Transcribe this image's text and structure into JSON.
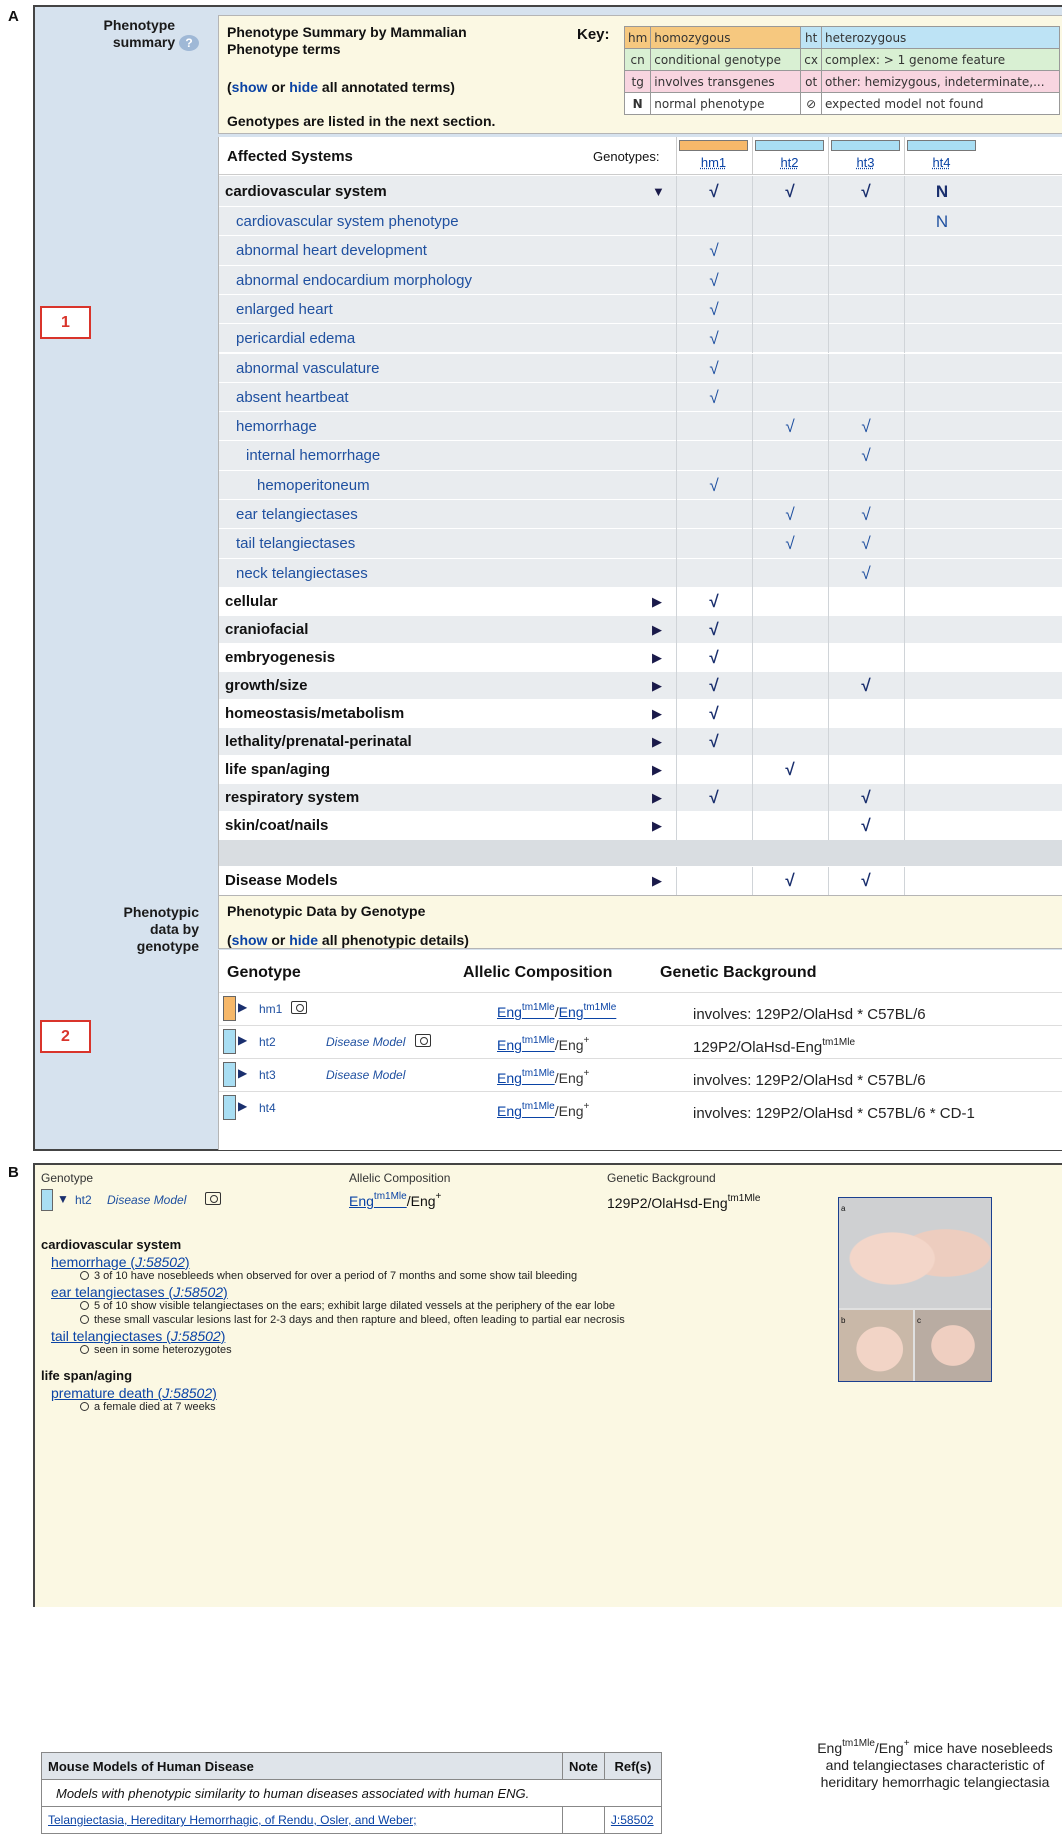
{
  "panel_a_label": "A",
  "panel_b_label": "B",
  "phenotype_summary": {
    "left_label": "Phenotype summary",
    "help_icon": "question-circle-icon",
    "title": "Phenotype Summary by Mammalian Phenotype terms",
    "show_label": "show",
    "or_label": " or ",
    "hide_label": "hide",
    "all_annotated_terms": " all annotated terms)",
    "genotypes_note": "Genotypes are listed in the next section.",
    "key_label": "Key:",
    "key_items": [
      {
        "abbr": "hm",
        "text": "homozygous",
        "color": "#f6c87f"
      },
      {
        "abbr": "ht",
        "text": "heterozygous",
        "color": "#bde3f5"
      },
      {
        "abbr": "cn",
        "text": "conditional genotype",
        "color": "#d9f0d3"
      },
      {
        "abbr": "cx",
        "text": "complex: > 1 genome feature",
        "color": "#d9f0d3"
      },
      {
        "abbr": "tg",
        "text": "involves transgenes",
        "color": "#f8d5e0"
      },
      {
        "abbr": "ot",
        "text": "other: hemizygous, indeterminate,...",
        "color": "#f8d5e0"
      },
      {
        "abbr": "N",
        "text": "normal phenotype",
        "color": "#ffffff"
      },
      {
        "abbr": "⊘",
        "text": "expected model not found",
        "color": "#ffffff"
      }
    ]
  },
  "affected_systems": {
    "title": "Affected Systems",
    "genotypes_label": "Genotypes:",
    "genotype_cols": [
      {
        "label": "hm1",
        "color": "#f6b86a"
      },
      {
        "label": "ht2",
        "color": "#a9def3"
      },
      {
        "label": "ht3",
        "color": "#a9def3"
      },
      {
        "label": "ht4",
        "color": "#a9def3"
      }
    ],
    "rows": [
      {
        "name": "cardiovascular system",
        "level": 0,
        "arrow": "▼",
        "cells": [
          "√",
          "√",
          "√",
          "N"
        ]
      },
      {
        "name": "cardiovascular system phenotype",
        "level": 1,
        "cells": [
          "",
          "",
          "",
          "N"
        ]
      },
      {
        "name": "abnormal heart development",
        "level": 1,
        "cells": [
          "√",
          "",
          "",
          ""
        ]
      },
      {
        "name": "abnormal endocardium morphology",
        "level": 1,
        "cells": [
          "√",
          "",
          "",
          ""
        ]
      },
      {
        "name": "enlarged heart",
        "level": 1,
        "cells": [
          "√",
          "",
          "",
          ""
        ]
      },
      {
        "name": "pericardial edema",
        "level": 1,
        "cells": [
          "√",
          "",
          "",
          ""
        ]
      },
      {
        "name": "abnormal vasculature",
        "level": 1,
        "cells": [
          "√",
          "",
          "",
          ""
        ]
      },
      {
        "name": "absent heartbeat",
        "level": 1,
        "cells": [
          "√",
          "",
          "",
          ""
        ]
      },
      {
        "name": "hemorrhage",
        "level": 1,
        "cells": [
          "",
          "√",
          "√",
          ""
        ]
      },
      {
        "name": "internal hemorrhage",
        "level": 2,
        "cells": [
          "",
          "",
          "√",
          ""
        ]
      },
      {
        "name": "hemoperitoneum",
        "level": 3,
        "cells": [
          "√",
          "",
          "",
          ""
        ]
      },
      {
        "name": "ear telangiectases",
        "level": 1,
        "cells": [
          "",
          "√",
          "√",
          ""
        ]
      },
      {
        "name": "tail telangiectases",
        "level": 1,
        "cells": [
          "",
          "√",
          "√",
          ""
        ]
      },
      {
        "name": "neck telangiectases",
        "level": 1,
        "cells": [
          "",
          "",
          "√",
          ""
        ]
      },
      {
        "name": "cellular",
        "level": 0,
        "arrow": "▶",
        "cells": [
          "√",
          "",
          "",
          ""
        ]
      },
      {
        "name": "craniofacial",
        "level": 0,
        "arrow": "▶",
        "cells": [
          "√",
          "",
          "",
          ""
        ]
      },
      {
        "name": "embryogenesis",
        "level": 0,
        "arrow": "▶",
        "cells": [
          "√",
          "",
          "",
          ""
        ]
      },
      {
        "name": "growth/size",
        "level": 0,
        "arrow": "▶",
        "cells": [
          "√",
          "",
          "√",
          ""
        ]
      },
      {
        "name": "homeostasis/metabolism",
        "level": 0,
        "arrow": "▶",
        "cells": [
          "√",
          "",
          "",
          ""
        ]
      },
      {
        "name": "lethality/prenatal-perinatal",
        "level": 0,
        "arrow": "▶",
        "cells": [
          "√",
          "",
          "",
          ""
        ]
      },
      {
        "name": "life span/aging",
        "level": 0,
        "arrow": "▶",
        "cells": [
          "",
          "√",
          "",
          ""
        ]
      },
      {
        "name": "respiratory system",
        "level": 0,
        "arrow": "▶",
        "cells": [
          "√",
          "",
          "√",
          ""
        ]
      },
      {
        "name": "skin/coat/nails",
        "level": 0,
        "arrow": "▶",
        "cells": [
          "",
          "",
          "√",
          ""
        ]
      }
    ],
    "disease_row": {
      "name": "Disease Models",
      "arrow": "▶",
      "cells": [
        "",
        "√",
        "√",
        ""
      ]
    }
  },
  "phenotypic_data": {
    "left_label": "Phenotypic data by genotype",
    "title": "Phenotypic Data by Genotype",
    "show_label": "show",
    "or_label": " or ",
    "hide_label": "hide",
    "all_details": " all phenotypic details)",
    "headers": {
      "genotype": "Genotype",
      "allelic": "Allelic Composition",
      "background": "Genetic Background"
    },
    "rows": [
      {
        "name": "hm1",
        "disease": "",
        "camera": true,
        "color": "#f6b86a",
        "a1": "Eng",
        "s1": "tm1Mle",
        "sep": "/",
        "a2": "Eng",
        "s2": "tm1Mle",
        "a2link": true,
        "bg": "involves: 129P2/OlaHsd * C57BL/6",
        "bgsup": ""
      },
      {
        "name": "ht2",
        "disease": "Disease Model",
        "camera": true,
        "color": "#a9def3",
        "a1": "Eng",
        "s1": "tm1Mle",
        "sep": "/",
        "a2": "Eng",
        "s2": "+",
        "a2link": false,
        "bg": "129P2/OlaHsd-Eng",
        "bgsup": "tm1Mle"
      },
      {
        "name": "ht3",
        "disease": "Disease Model",
        "camera": false,
        "color": "#a9def3",
        "a1": "Eng",
        "s1": "tm1Mle",
        "sep": "/",
        "a2": "Eng",
        "s2": "+",
        "a2link": false,
        "bg": "involves: 129P2/OlaHsd * C57BL/6",
        "bgsup": ""
      },
      {
        "name": "ht4",
        "disease": "",
        "camera": false,
        "color": "#a9def3",
        "a1": "Eng",
        "s1": "tm1Mle",
        "sep": "/",
        "a2": "Eng",
        "s2": "+",
        "a2link": false,
        "bg": "involves: 129P2/OlaHsd * C57BL/6 * CD-1",
        "bgsup": ""
      }
    ]
  },
  "callouts": [
    "1",
    "2"
  ],
  "panel_b": {
    "headers": {
      "genotype": "Genotype",
      "allelic": "Allelic Composition",
      "background": "Genetic Background"
    },
    "genotype": "ht2",
    "disease": "Disease Model",
    "a1": "Eng",
    "s1": "tm1Mle",
    "sep": "/",
    "a2": "Eng",
    "s2": "+",
    "bg": "129P2/OlaHsd-Eng",
    "bgsup": "tm1Mle",
    "sections": [
      {
        "system": "cardiovascular system",
        "terms": [
          {
            "term": "hemorrhage",
            "ref": "J:58502",
            "notes": [
              "3 of 10 have nosebleeds when observed for over a period of 7 months and some show tail bleeding"
            ]
          },
          {
            "term": "ear telangiectases",
            "ref": "J:58502",
            "notes": [
              "5 of 10 show visible telangiectases on the ears; exhibit large dilated vessels at the periphery of the ear lobe",
              "these small vascular lesions last for 2-3 days and then rapture and bleed, often leading to partial ear necrosis"
            ]
          },
          {
            "term": "tail telangiectases",
            "ref": "J:58502",
            "notes": [
              "seen in some heterozygotes"
            ]
          }
        ]
      },
      {
        "system": "life span/aging",
        "terms": [
          {
            "term": "premature death",
            "ref": "J:58502",
            "notes": [
              "a female died at 7 weeks"
            ]
          }
        ]
      }
    ],
    "mmhd": {
      "title": "Mouse Models of Human Disease",
      "note_header": "Note",
      "ref_header": "Ref(s)",
      "subtitle": "Models with phenotypic similarity to human diseases associated with human ENG.",
      "disease": "Telangiectasia, Hereditary Hemorrhagic, of Rendu, Osler, and Weber;",
      "ref": "J:58502"
    },
    "photo_letters": [
      "a",
      "b",
      "c"
    ],
    "caption_pre": "Eng",
    "caption_s1": "tm1Mle",
    "caption_sep": "/Eng",
    "caption_s2": "+",
    "caption_rest": " mice have nosebleeds and telangiectases characteristic of heriditary hemorrhagic telangiectasia"
  }
}
